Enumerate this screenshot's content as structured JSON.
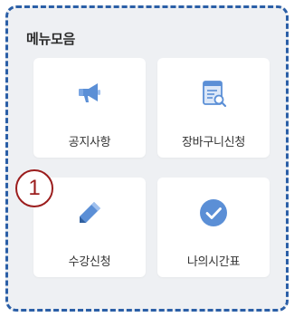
{
  "menu": {
    "title": "메뉴모음",
    "items": [
      {
        "label": "공지사항",
        "icon": "megaphone-icon"
      },
      {
        "label": "장바구니신청",
        "icon": "document-search-icon"
      },
      {
        "label": "수강신청",
        "icon": "pencil-icon"
      },
      {
        "label": "나의시간표",
        "icon": "check-circle-icon"
      }
    ]
  },
  "annotation": {
    "step": "1"
  },
  "colors": {
    "border": "#2b5fa7",
    "panel_bg": "#eef0f3",
    "icon_blue": "#5b8fd6",
    "annotation": "#9b1d1d"
  }
}
